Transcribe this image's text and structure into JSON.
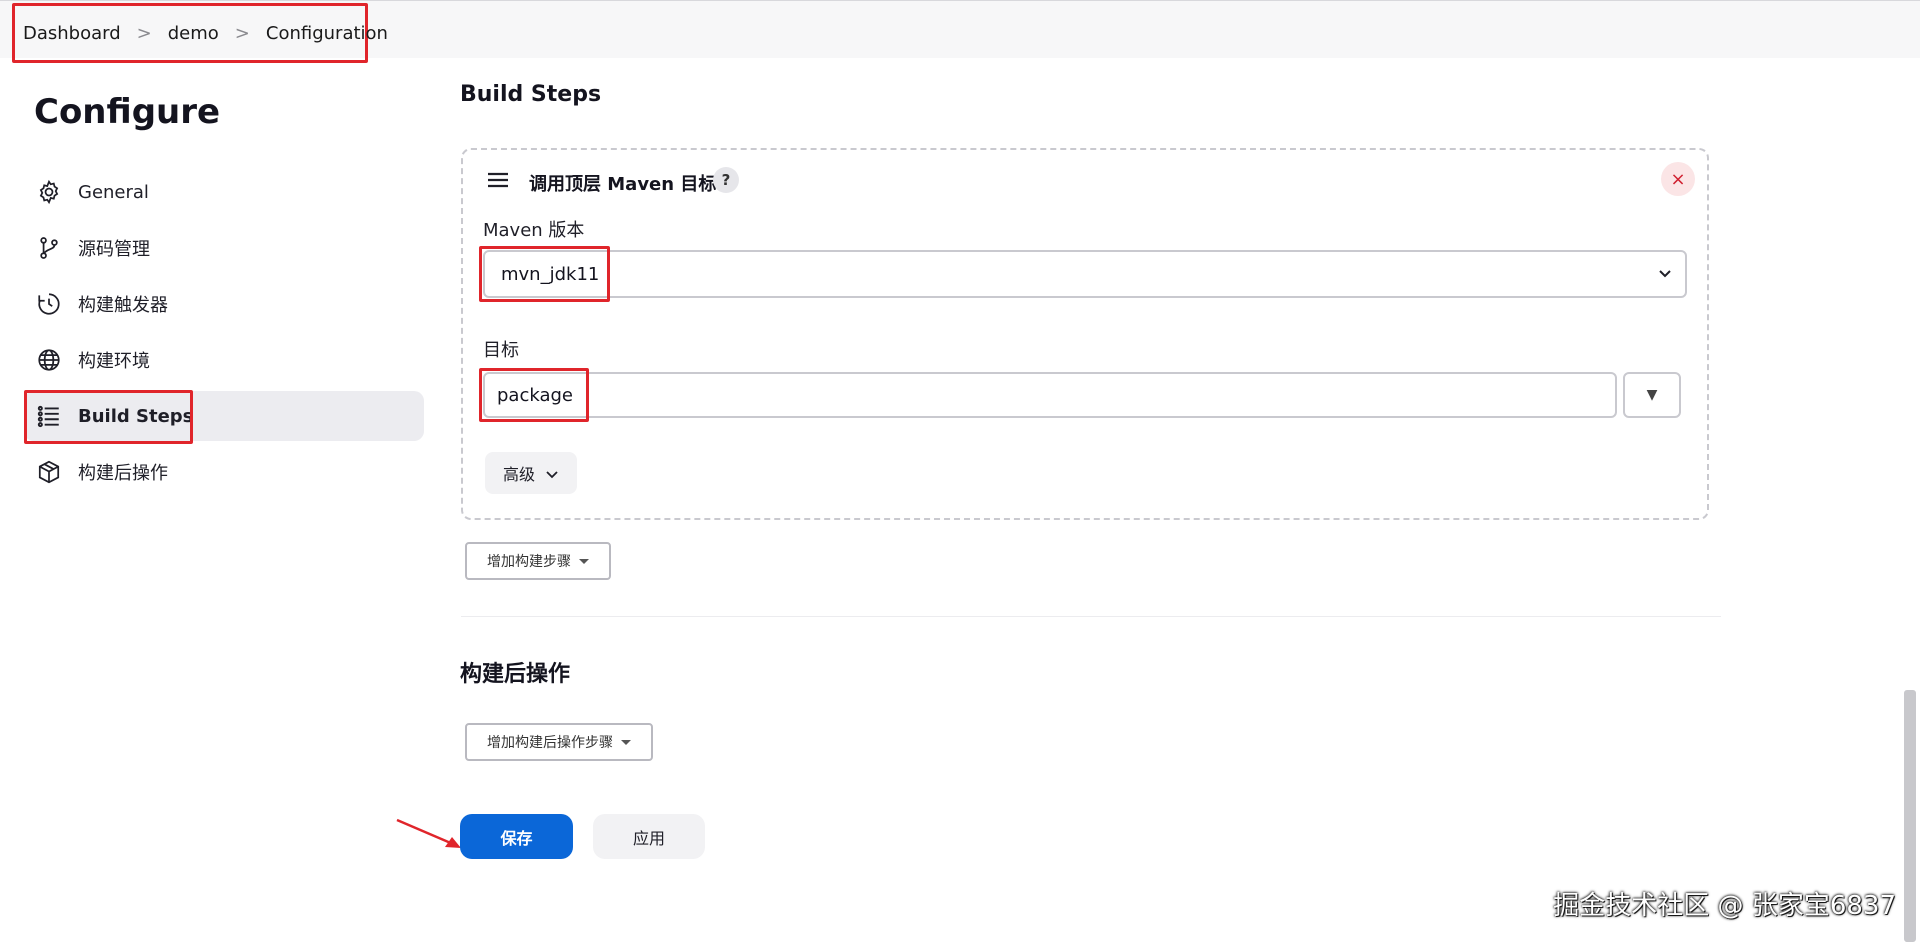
{
  "breadcrumb": {
    "items": [
      "Dashboard",
      "demo",
      "Configuration"
    ],
    "separator": ">"
  },
  "page": {
    "title": "Configure"
  },
  "sidebar": {
    "items": [
      {
        "label": "General",
        "icon": "gear-icon"
      },
      {
        "label": "源码管理",
        "icon": "branch-icon"
      },
      {
        "label": "构建触发器",
        "icon": "clock-icon"
      },
      {
        "label": "构建环境",
        "icon": "globe-icon"
      },
      {
        "label": "Build Steps",
        "icon": "list-icon",
        "active": true
      },
      {
        "label": "构建后操作",
        "icon": "package-icon"
      }
    ]
  },
  "build_steps": {
    "section_title": "Build Steps",
    "step": {
      "title": "调用顶层 Maven 目标",
      "help": "?",
      "close": "×",
      "maven_version_label": "Maven 版本",
      "maven_version_value": "mvn_jdk11",
      "goals_label": "目标",
      "goals_value": "package",
      "dropdown_glyph": "▼",
      "advanced_label": "高级"
    },
    "add_step_label": "增加构建步骤"
  },
  "post_build": {
    "section_title": "构建后操作",
    "add_step_label": "增加构建后操作步骤"
  },
  "actions": {
    "save_label": "保存",
    "apply_label": "应用"
  },
  "credit": "掘金技术社区 @ 张家宝6837",
  "colors": {
    "accent": "#0b67d8",
    "highlight": "#e0252b",
    "close": "#d02030"
  }
}
